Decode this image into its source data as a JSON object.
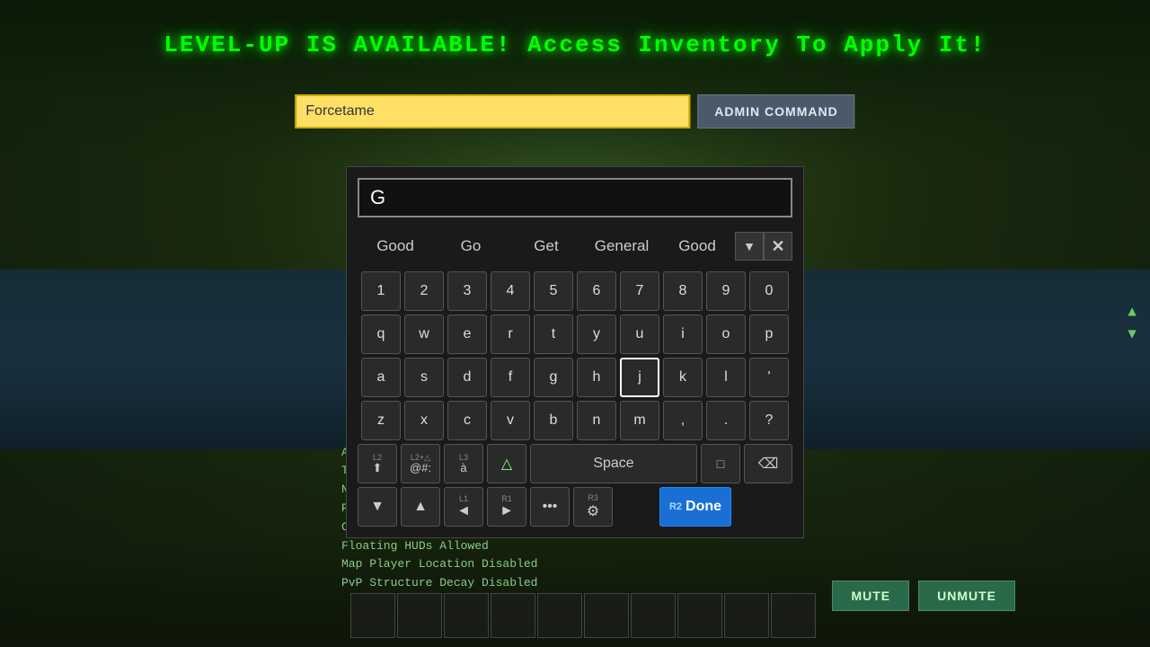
{
  "background": {
    "color": "#1a2a1a"
  },
  "banner": {
    "text": "LEVEL-UP IS AVAILABLE!  Access Inventory To Apply It!"
  },
  "admin": {
    "input_value": "Forcetame",
    "input_placeholder": "Forcetame",
    "button_label": "ADMIN COMMAND"
  },
  "keyboard": {
    "search_value": "G",
    "autocomplete": [
      "Good",
      "Go",
      "Get",
      "General",
      "Good"
    ],
    "rows": {
      "numbers": [
        "1",
        "2",
        "3",
        "4",
        "5",
        "6",
        "7",
        "8",
        "9",
        "0"
      ],
      "row1": [
        "q",
        "w",
        "e",
        "r",
        "t",
        "y",
        "u",
        "i",
        "o",
        "p"
      ],
      "row2": [
        "a",
        "s",
        "d",
        "f",
        "g",
        "h",
        "j",
        "k",
        "l",
        "'"
      ],
      "row3": [
        "z",
        "x",
        "c",
        "v",
        "b",
        "n",
        "m",
        ",",
        ".",
        "?"
      ],
      "special_bottom_left": [
        {
          "top": "L2",
          "main": "⬆"
        },
        {
          "top": "L2+△",
          "main": "@#:"
        },
        {
          "top": "L3",
          "main": "à"
        }
      ],
      "space_label": "Space",
      "func_row": [
        {
          "btn": "▼",
          "label": ""
        },
        {
          "btn": "▲",
          "label": ""
        },
        {
          "btn": "◄",
          "label": "L1"
        },
        {
          "btn": "►",
          "label": "R1"
        },
        {
          "btn": "...",
          "label": ""
        },
        {
          "btn": "🎮",
          "label": "R3"
        },
        {
          "btn": "",
          "label": ""
        },
        {
          "btn": "Done",
          "label": "R2"
        }
      ]
    },
    "highlighted_key": "j",
    "done_label": "Done"
  },
  "server_info": {
    "lines": [
      "ARK Data Downloads Allowed",
      "Third Person Allowed",
      "Non-Hardcore Mode",
      "PvPvE",
      "Crosshair Disabled",
      "Floating HUDs Allowed",
      "Map Player Location Disabled",
      "PvP Structure Decay Disabled"
    ]
  },
  "controls": {
    "mute_label": "MUTE",
    "unmute_label": "UNMUTE"
  }
}
